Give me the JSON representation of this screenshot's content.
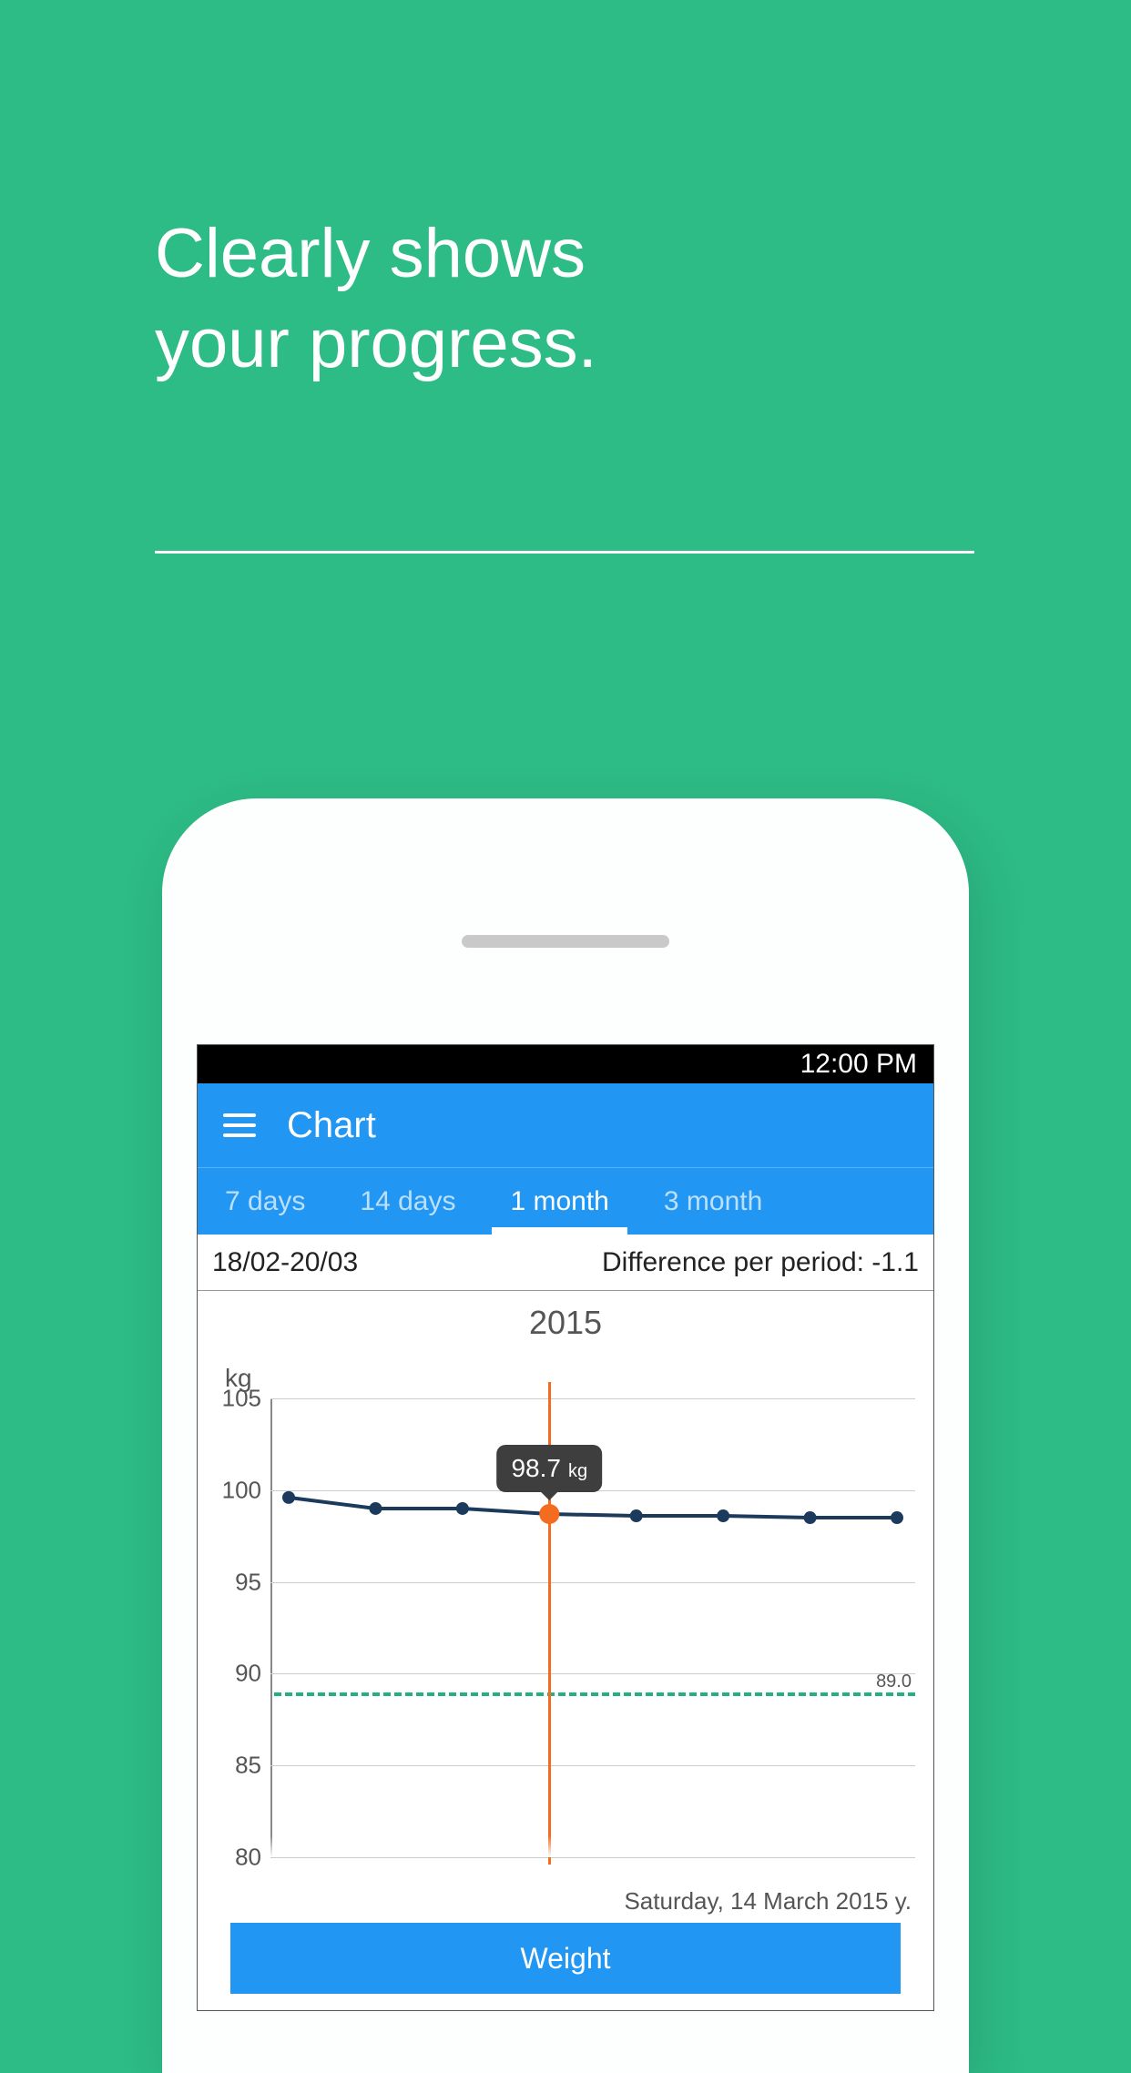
{
  "promo": {
    "headline_line1": "Clearly shows",
    "headline_line2": "your progress."
  },
  "status_bar": {
    "time": "12:00 PM"
  },
  "app_bar": {
    "title": "Chart"
  },
  "tabs": [
    {
      "label": "7 days",
      "active": false
    },
    {
      "label": "14 days",
      "active": false
    },
    {
      "label": "1 month",
      "active": true
    },
    {
      "label": "3 month",
      "active": false
    }
  ],
  "period": {
    "range": "18/02-20/03",
    "diff_label": "Difference per period: -1.1"
  },
  "chart_data": {
    "type": "line",
    "title": "2015",
    "ylabel": "kg",
    "ylim": [
      80,
      105
    ],
    "y_ticks": [
      80,
      85,
      90,
      95,
      100,
      105
    ],
    "target": {
      "value": 89.0,
      "label": "89.0"
    },
    "highlight": {
      "index": 3,
      "value": 98.7,
      "unit": "kg",
      "date": "Saturday, 14 March 2015 y."
    },
    "series": [
      {
        "name": "Weight",
        "values": [
          99.6,
          99.0,
          99.0,
          98.7,
          98.6,
          98.6,
          98.5,
          98.5
        ]
      }
    ]
  },
  "bottom_button": {
    "label": "Weight"
  }
}
